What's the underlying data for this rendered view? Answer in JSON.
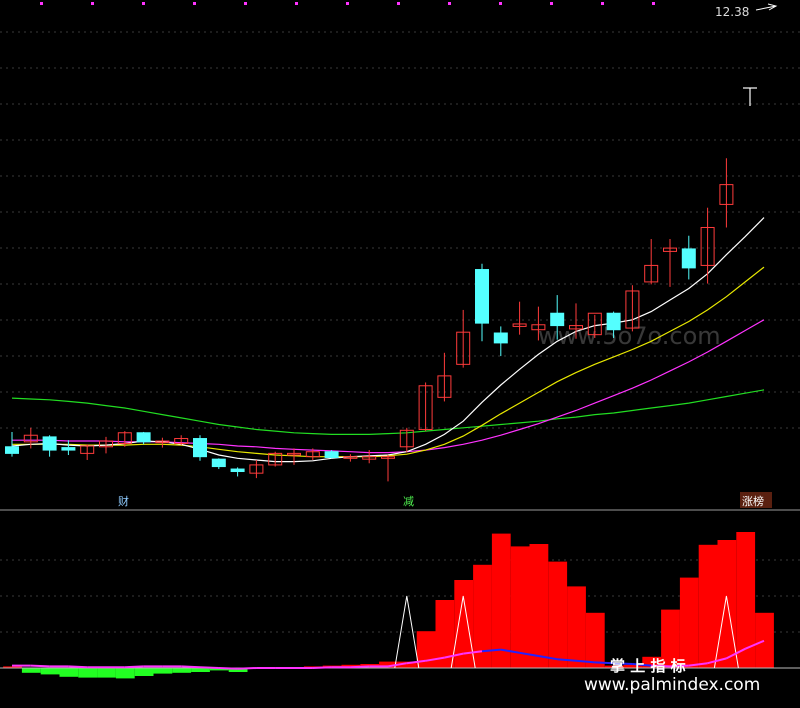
{
  "header": {
    "price_label": "12.38"
  },
  "markers": {
    "cai": "财",
    "jian": "减",
    "zhangbang": "涨榜"
  },
  "watermarks": {
    "cn": "掌  上  指  标",
    "url": "www.palmindex.com",
    "faint": "www.5o7o.com"
  },
  "colors": {
    "background": "#000000",
    "up_candle": "#ff3b3b",
    "down_candle": "#54ffff",
    "ma_fast": "#ffffff",
    "ma_mid": "#e8e800",
    "ma_slow": "#ff33ff",
    "ma_long": "#22dd22",
    "hist_pos": "#ff0000",
    "hist_neg": "#22ff22",
    "osc_line": "#ff33ff",
    "osc_blue": "#2222ff",
    "grid_dash": "#7a1e1e"
  },
  "chart_data": [
    {
      "type": "candlestick",
      "y_axis": "price (unlabeled)",
      "candles": [
        {
          "o": 100.0,
          "h": 101.8,
          "l": 98.8,
          "c": 99.2
        },
        {
          "o": 100.6,
          "h": 102.3,
          "l": 99.8,
          "c": 101.4
        },
        {
          "o": 101.2,
          "h": 101.4,
          "l": 98.8,
          "c": 99.6
        },
        {
          "o": 99.9,
          "h": 100.8,
          "l": 99.0,
          "c": 99.6
        },
        {
          "o": 99.2,
          "h": 100.3,
          "l": 98.4,
          "c": 100.1
        },
        {
          "o": 100.0,
          "h": 101.2,
          "l": 99.2,
          "c": 100.7
        },
        {
          "o": 100.4,
          "h": 101.9,
          "l": 100.0,
          "c": 101.7
        },
        {
          "o": 101.7,
          "h": 101.8,
          "l": 100.3,
          "c": 100.6
        },
        {
          "o": 100.5,
          "h": 101.1,
          "l": 99.9,
          "c": 100.7
        },
        {
          "o": 100.4,
          "h": 101.4,
          "l": 100.2,
          "c": 101.0
        },
        {
          "o": 101.0,
          "h": 101.4,
          "l": 98.3,
          "c": 98.8
        },
        {
          "o": 98.5,
          "h": 98.6,
          "l": 97.3,
          "c": 97.6
        },
        {
          "o": 97.3,
          "h": 97.5,
          "l": 96.4,
          "c": 97.0
        },
        {
          "o": 96.8,
          "h": 98.4,
          "l": 96.2,
          "c": 97.8
        },
        {
          "o": 97.8,
          "h": 99.4,
          "l": 97.6,
          "c": 99.2
        },
        {
          "o": 99.0,
          "h": 99.8,
          "l": 97.8,
          "c": 99.2
        },
        {
          "o": 98.8,
          "h": 99.8,
          "l": 98.4,
          "c": 99.4
        },
        {
          "o": 99.4,
          "h": 99.6,
          "l": 98.6,
          "c": 98.7
        },
        {
          "o": 98.6,
          "h": 99.1,
          "l": 98.2,
          "c": 98.8
        },
        {
          "o": 98.5,
          "h": 99.6,
          "l": 98.0,
          "c": 98.8
        },
        {
          "o": 98.6,
          "h": 99.0,
          "l": 95.8,
          "c": 98.8
        },
        {
          "o": 100.0,
          "h": 102.3,
          "l": 99.3,
          "c": 102.0
        },
        {
          "o": 102.1,
          "h": 107.8,
          "l": 101.9,
          "c": 107.4
        },
        {
          "o": 106.0,
          "h": 111.4,
          "l": 105.5,
          "c": 108.6
        },
        {
          "o": 110.0,
          "h": 116.6,
          "l": 109.6,
          "c": 113.9
        },
        {
          "o": 121.5,
          "h": 122.2,
          "l": 112.8,
          "c": 115.0
        },
        {
          "o": 113.8,
          "h": 114.6,
          "l": 111.0,
          "c": 112.6
        },
        {
          "o": 114.6,
          "h": 117.6,
          "l": 113.6,
          "c": 114.9
        },
        {
          "o": 114.2,
          "h": 117.0,
          "l": 112.9,
          "c": 114.8
        },
        {
          "o": 116.2,
          "h": 118.4,
          "l": 113.0,
          "c": 114.7
        },
        {
          "o": 114.3,
          "h": 117.4,
          "l": 113.1,
          "c": 114.7
        },
        {
          "o": 113.6,
          "h": 116.0,
          "l": 113.2,
          "c": 116.2
        },
        {
          "o": 116.2,
          "h": 116.4,
          "l": 113.2,
          "c": 114.2
        },
        {
          "o": 114.4,
          "h": 119.6,
          "l": 114.0,
          "c": 118.9
        },
        {
          "o": 120.0,
          "h": 125.2,
          "l": 119.7,
          "c": 122.0
        },
        {
          "o": 123.7,
          "h": 125.2,
          "l": 119.4,
          "c": 124.1
        },
        {
          "o": 124.0,
          "h": 125.6,
          "l": 120.3,
          "c": 121.7
        },
        {
          "o": 122.0,
          "h": 129.0,
          "l": 119.8,
          "c": 126.6
        },
        {
          "o": 129.4,
          "h": 135.0,
          "l": 126.6,
          "c": 131.8
        }
      ],
      "ma_fast": [
        100.1,
        100.3,
        100.4,
        100.2,
        100.1,
        100.2,
        100.4,
        100.7,
        100.6,
        100.3,
        99.7,
        99.0,
        98.6,
        98.4,
        98.2,
        98.2,
        98.3,
        98.6,
        98.8,
        98.9,
        99.0,
        99.4,
        100.3,
        101.5,
        103.1,
        105.4,
        107.5,
        109.4,
        111.2,
        112.8,
        114.0,
        114.7,
        115.0,
        115.4,
        116.4,
        117.8,
        119.2,
        121.0,
        123.3,
        125.5,
        127.8
      ],
      "ma_mid": [
        100.3,
        100.3,
        100.3,
        100.3,
        100.2,
        100.2,
        100.2,
        100.3,
        100.3,
        100.2,
        100.0,
        99.7,
        99.4,
        99.2,
        99.0,
        98.9,
        98.8,
        98.8,
        98.8,
        98.8,
        98.9,
        99.1,
        99.6,
        100.3,
        101.3,
        102.6,
        104.0,
        105.3,
        106.6,
        107.9,
        109.0,
        110.0,
        110.9,
        111.8,
        112.8,
        114.0,
        115.2,
        116.6,
        118.2,
        120.0,
        121.8
      ],
      "ma_slow": [
        100.8,
        100.8,
        100.8,
        100.7,
        100.7,
        100.7,
        100.6,
        100.6,
        100.6,
        100.5,
        100.4,
        100.3,
        100.1,
        100.0,
        99.8,
        99.7,
        99.6,
        99.5,
        99.4,
        99.3,
        99.3,
        99.4,
        99.6,
        99.9,
        100.3,
        100.8,
        101.4,
        102.1,
        102.8,
        103.6,
        104.4,
        105.3,
        106.2,
        107.1,
        108.1,
        109.2,
        110.3,
        111.5,
        112.8,
        114.1,
        115.4
      ],
      "ma_long": [
        105.9,
        105.8,
        105.7,
        105.5,
        105.3,
        105.0,
        104.7,
        104.3,
        103.9,
        103.5,
        103.1,
        102.7,
        102.4,
        102.1,
        101.9,
        101.7,
        101.6,
        101.5,
        101.5,
        101.5,
        101.6,
        101.7,
        101.9,
        102.1,
        102.3,
        102.5,
        102.7,
        102.9,
        103.1,
        103.4,
        103.6,
        103.9,
        104.1,
        104.4,
        104.7,
        105.0,
        105.3,
        105.7,
        106.1,
        106.5,
        106.9
      ],
      "markers": [
        {
          "index": 6,
          "label": "财"
        },
        {
          "index": 21,
          "label": "减"
        },
        {
          "index": 39,
          "label": "涨榜"
        }
      ]
    },
    {
      "type": "bar",
      "y_axis": "oscillator (unlabeled)",
      "histogram": [
        0.2,
        -0.6,
        -0.8,
        -1.1,
        -1.2,
        -1.2,
        -1.3,
        -1.0,
        -0.7,
        -0.6,
        -0.5,
        -0.3,
        -0.5,
        -0.1,
        0.1,
        0.1,
        0.2,
        0.3,
        0.4,
        0.5,
        0.8,
        0.8,
        4.6,
        8.5,
        11.0,
        12.9,
        16.8,
        15.2,
        15.5,
        13.3,
        10.2,
        6.9,
        0.3,
        0.4,
        1.4,
        7.3,
        11.3,
        15.4,
        16.0,
        17.0,
        6.9
      ],
      "signal_line": [
        0.3,
        0.3,
        0.2,
        0.2,
        0.1,
        0.1,
        0.1,
        0.2,
        0.2,
        0.2,
        0.1,
        0.0,
        -0.1,
        0.0,
        0.0,
        0.0,
        0.0,
        0.1,
        0.1,
        0.2,
        0.2,
        0.6,
        0.9,
        1.3,
        1.8,
        2.1,
        2.3,
        1.9,
        1.5,
        1.1,
        0.9,
        0.7,
        0.6,
        0.5,
        0.3,
        0.2,
        0.3,
        0.6,
        1.2,
        2.4,
        3.4
      ],
      "spikes_index": [
        21,
        24,
        38
      ]
    }
  ]
}
